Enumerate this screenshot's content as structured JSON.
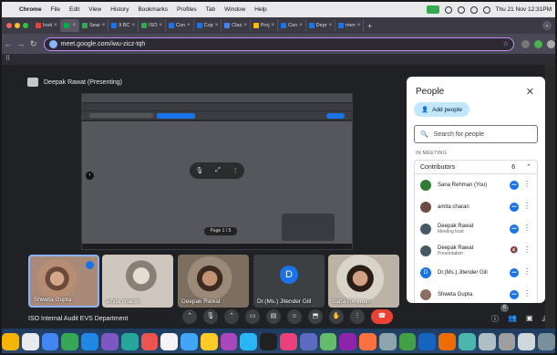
{
  "menubar": {
    "app": "Chrome",
    "items": [
      "File",
      "Edit",
      "View",
      "History",
      "Bookmarks",
      "Profiles",
      "Tab",
      "Window",
      "Help"
    ],
    "clock": "Thu 21 Nov  12:31PM"
  },
  "tabs": [
    {
      "label": "Invit",
      "color": "#ea4335"
    },
    {
      "label": "",
      "color": "#00ac47",
      "active": true
    },
    {
      "label": "Sear",
      "color": "#34a853"
    },
    {
      "label": "II BC",
      "color": "#1a73e8"
    },
    {
      "label": "ISO",
      "color": "#34a853"
    },
    {
      "label": "Con",
      "color": "#1a73e8"
    },
    {
      "label": "Cop",
      "color": "#1a73e8"
    },
    {
      "label": "Clas",
      "color": "#4285f4"
    },
    {
      "label": "Proj",
      "color": "#fbbc04"
    },
    {
      "label": "Con",
      "color": "#1a73e8"
    },
    {
      "label": "Depr",
      "color": "#1a73e8"
    },
    {
      "label": "men",
      "color": "#1a73e8"
    }
  ],
  "address": {
    "url": "meet.google.com/iwu-zicz-tqh"
  },
  "meet": {
    "presenter": "Deepak Rawat (Presenting)",
    "shared_page": "Page 1 / 5",
    "meeting_name": "ISO Internal Audit EVS Department",
    "participant_count": "6",
    "tiles": [
      {
        "name": "Shweta Gupta",
        "photo": "ph1",
        "selected": true
      },
      {
        "name": "amita charan",
        "photo": "ph2"
      },
      {
        "name": "Deepak Rawat",
        "photo": "ph3"
      },
      {
        "name": "Dr.(Ms.) Jitender Gill",
        "initial": "D"
      },
      {
        "name": "Sana Rehman",
        "photo": "ph5"
      }
    ]
  },
  "people": {
    "title": "People",
    "add_label": "Add people",
    "search_placeholder": "Search for people",
    "section": "IN MEETING",
    "group_label": "Contributors",
    "group_count": "6",
    "members": [
      {
        "name": "Sana Rehman (You)",
        "sub": "",
        "status": "speaking",
        "avatar_color": "#2e7d32"
      },
      {
        "name": "amita charan",
        "sub": "",
        "status": "speaking",
        "avatar_color": "#6d4c41"
      },
      {
        "name": "Deepak Rawat",
        "sub": "Meeting host",
        "status": "speaking",
        "avatar_color": "#455a64"
      },
      {
        "name": "Deepak Rawat",
        "sub": "Presentation",
        "status": "muted",
        "avatar_color": "#455a64"
      },
      {
        "name": "Dr.(Ms.) Jitender Gill",
        "sub": "",
        "status": "speaking",
        "avatar_color": "#1a73e8",
        "initial": "D"
      },
      {
        "name": "Shweta Gupta",
        "sub": "",
        "status": "speaking",
        "avatar_color": "#8d6e63"
      }
    ]
  },
  "colors": {
    "accent": "#1a73e8",
    "end_call": "#ea4335",
    "omnibox_border": "#c58af9"
  }
}
